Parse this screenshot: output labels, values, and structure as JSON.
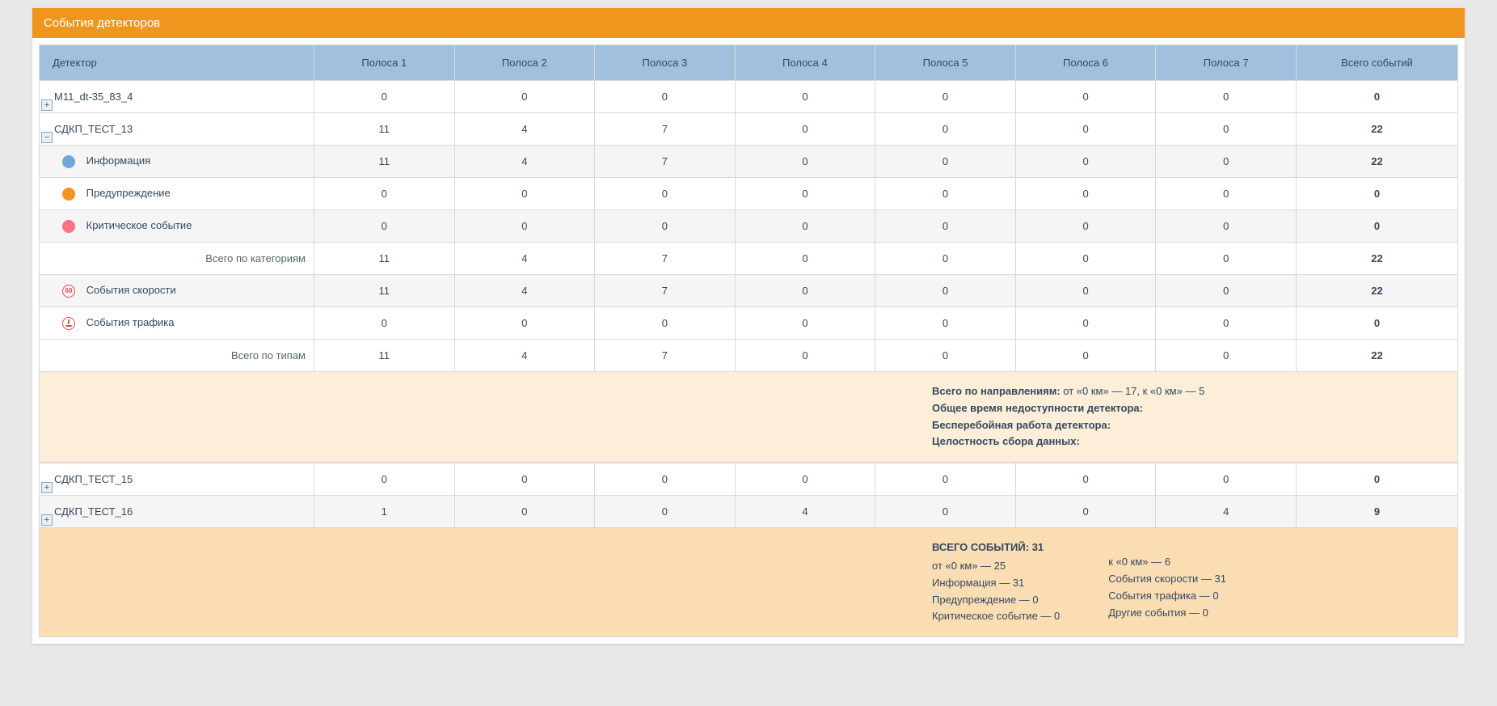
{
  "title": "События детекторов",
  "columns": [
    "Детектор",
    "Полоса 1",
    "Полоса 2",
    "Полоса 3",
    "Полоса 4",
    "Полоса 5",
    "Полоса 6",
    "Полоса 7",
    "Всего событий"
  ],
  "row_det1": {
    "name": "M11_dt-35_83_4",
    "v": [
      "0",
      "0",
      "0",
      "0",
      "0",
      "0",
      "0",
      "0"
    ]
  },
  "row_det2": {
    "name": "СДКП_ТЕСТ_13",
    "v": [
      "11",
      "4",
      "7",
      "0",
      "0",
      "0",
      "0",
      "22"
    ],
    "cat_info": {
      "label": "Информация",
      "v": [
        "11",
        "4",
        "7",
        "0",
        "0",
        "0",
        "0",
        "22"
      ]
    },
    "cat_warn": {
      "label": "Предупреждение",
      "v": [
        "0",
        "0",
        "0",
        "0",
        "0",
        "0",
        "0",
        "0"
      ]
    },
    "cat_crit": {
      "label": "Критическое событие",
      "v": [
        "0",
        "0",
        "0",
        "0",
        "0",
        "0",
        "0",
        "0"
      ]
    },
    "cat_total": {
      "label": "Всего по категориям",
      "v": [
        "11",
        "4",
        "7",
        "0",
        "0",
        "0",
        "0",
        "22"
      ]
    },
    "type_speed": {
      "label": "События скорости",
      "v": [
        "11",
        "4",
        "7",
        "0",
        "0",
        "0",
        "0",
        "22"
      ]
    },
    "type_traf": {
      "label": "События трафика",
      "v": [
        "0",
        "0",
        "0",
        "0",
        "0",
        "0",
        "0",
        "0"
      ]
    },
    "type_total": {
      "label": "Всего по типам",
      "v": [
        "11",
        "4",
        "7",
        "0",
        "0",
        "0",
        "0",
        "22"
      ]
    },
    "info_lines": {
      "dir_label": "Всего по направлениям:",
      "dir_val": " от «0 км» — 17, к «0 км» — 5",
      "unavail": "Общее время недоступности детектора:",
      "uptime": "Бесперебойная работа детектора:",
      "integrity": "Целостность сбора данных:"
    }
  },
  "row_det3": {
    "name": "СДКП_ТЕСТ_15",
    "v": [
      "0",
      "0",
      "0",
      "0",
      "0",
      "0",
      "0",
      "0"
    ]
  },
  "row_det4": {
    "name": "СДКП_ТЕСТ_16",
    "v": [
      "1",
      "0",
      "0",
      "4",
      "0",
      "0",
      "4",
      "9"
    ]
  },
  "summary": {
    "title": "ВСЕГО СОБЫТИЙ: 31",
    "left": {
      "l1": "от «0 км» — 25",
      "l2": "Информация — 31",
      "l3": "Предупреждение — 0",
      "l4": "Критическое событие — 0"
    },
    "right": {
      "l1": "к «0 км» — 6",
      "l2": "События скорости — 31",
      "l3": "События трафика — 0",
      "l4": "Другие события — 0"
    }
  },
  "icons": {
    "speed_inner": "60"
  }
}
